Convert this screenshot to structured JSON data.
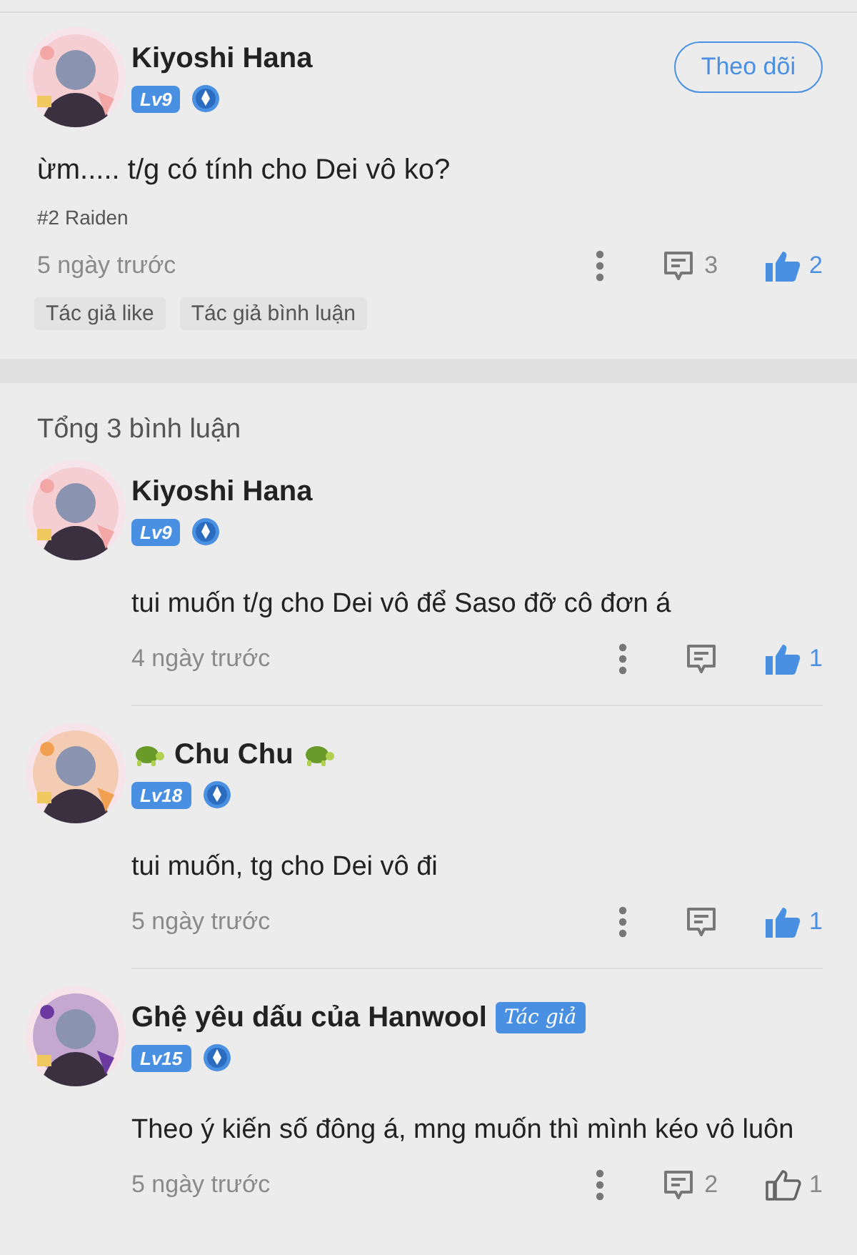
{
  "post": {
    "author": "Kiyoshi Hana",
    "level": "Lv9",
    "follow_button": "Theo dõi",
    "text": "ừm..... t/g có tính cho Dei vô ko?",
    "tag": "#2 Raiden",
    "time": "5 ngày trước",
    "comment_count": "3",
    "like_count": "2",
    "liked": true,
    "labels": [
      "Tác giả like",
      "Tác giả bình luận"
    ]
  },
  "replies_header": "Tổng 3 bình luận",
  "replies": [
    {
      "author": "Kiyoshi Hana",
      "level": "Lv9",
      "turtles": false,
      "text": "tui  muốn t/g cho Dei vô để Saso đỡ cô đơn á",
      "time": "4 ngày trước",
      "like_count": "1",
      "liked": true
    },
    {
      "author": "Chu Chu",
      "level": "Lv18",
      "turtles": true,
      "text": "tui muốn, tg cho Dei vô đi",
      "time": "5 ngày trước",
      "like_count": "1",
      "liked": true
    },
    {
      "author": "Ghệ yêu dấu của Hanwool",
      "level": "Lv15",
      "turtles": false,
      "author_badge": "Tác giả",
      "text": "Theo ý kiến số đông á, mng muốn thì mình kéo vô luôn",
      "time": "5 ngày trước",
      "comment_count": "2",
      "like_count": "1",
      "liked": false
    }
  ]
}
